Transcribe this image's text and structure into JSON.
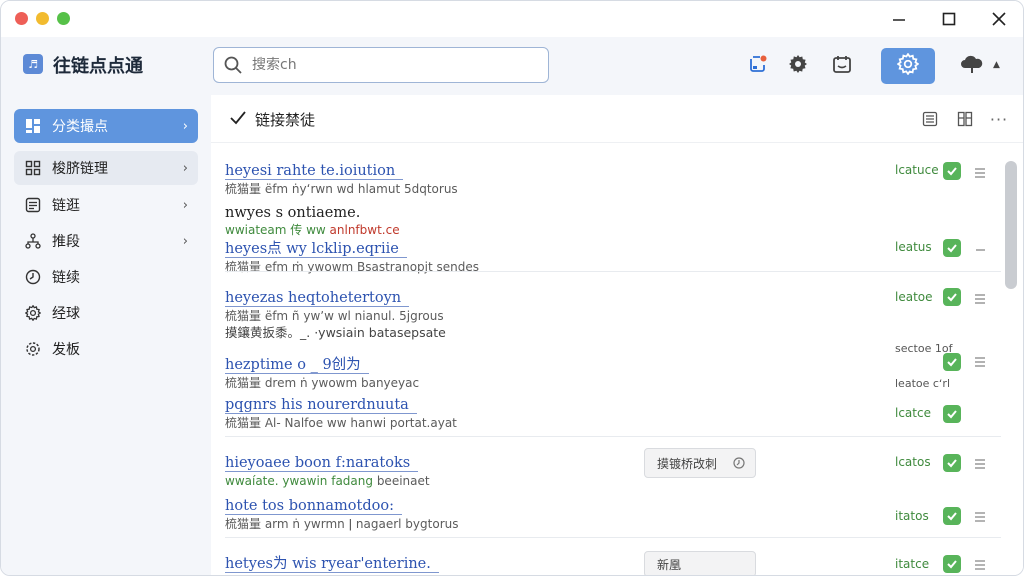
{
  "app": {
    "name": "往链点点通",
    "logo_glyph": "♬"
  },
  "search": {
    "placeholder": "搜索ch"
  },
  "sidebar": {
    "items": [
      {
        "label": "分类撮点",
        "icon": "grid-icon",
        "chevron": true,
        "state": "active"
      },
      {
        "label": "梭脐链理",
        "icon": "apps-icon",
        "chevron": true,
        "state": "hover"
      },
      {
        "label": "链逛",
        "icon": "list-icon",
        "chevron": true,
        "state": ""
      },
      {
        "label": "推段",
        "icon": "tree-icon",
        "chevron": true,
        "state": ""
      },
      {
        "label": "链续",
        "icon": "clock-icon",
        "chevron": false,
        "state": ""
      },
      {
        "label": "经球",
        "icon": "gear-small-icon",
        "chevron": false,
        "state": ""
      },
      {
        "label": "发板",
        "icon": "settings-icon",
        "chevron": false,
        "state": ""
      }
    ]
  },
  "main": {
    "title": "链接禁徒",
    "rows": [
      {
        "title": "heyesi rahte te.ioiution",
        "sub": "梳猫量 ëfm ṅyʻrwn wd hlamut 5dqtorus",
        "status": "lcatuce"
      },
      {
        "title": "nwyes s ontiaeme.",
        "sub_green": "wwiateam 传 ww ",
        "sub_red": "anlnfbwt.ce",
        "title2": "heyes点 wy lcklip.eqriie",
        "sub2": "梳猫量 efm ṁ ywowm Bsastranopjt sendes",
        "status": "leatus"
      },
      {
        "title": "heyezas heqtohetertoyn",
        "sub": "梳猫量 ëfm ñ ywʼw wl nianul. 5jgrous",
        "status": "leatoe"
      },
      {
        "plain": "摸鑲黄扳黍。_. ·ywsiain batasepsate"
      },
      {
        "title": "hezptime o _ 9创为",
        "sub": "梳猫量 drem ṅ ywowm banyeyac",
        "status": "sectoe 1of",
        "status2": "leatoe cʻrl"
      },
      {
        "title": "pqgnrs his nourerdnuuta",
        "sub": "梳猫量 Al- Nalfoe ww hanwi portat.ayat",
        "status": "lcatce"
      },
      {
        "title": "hieyoaee boon f:naratoks",
        "sub_green": "wwaíate. ywawin fadang",
        "sub_rest": " beeinaet",
        "tag": "摸镀桥改刺",
        "status": "lcatos"
      },
      {
        "title": "hote tos bonnamotdoo:",
        "sub": "梳猫量 arm ṅ ywrmn ǀ nagaerl bygtorus",
        "status": "itatos"
      },
      {
        "title": "hetyes为 wis ryear'enterine.",
        "sub": "",
        "tag": "新凰",
        "status": "itatce"
      }
    ]
  },
  "colors": {
    "accent": "#5f95de",
    "ok": "#58b45a",
    "link": "#2d53b0"
  }
}
